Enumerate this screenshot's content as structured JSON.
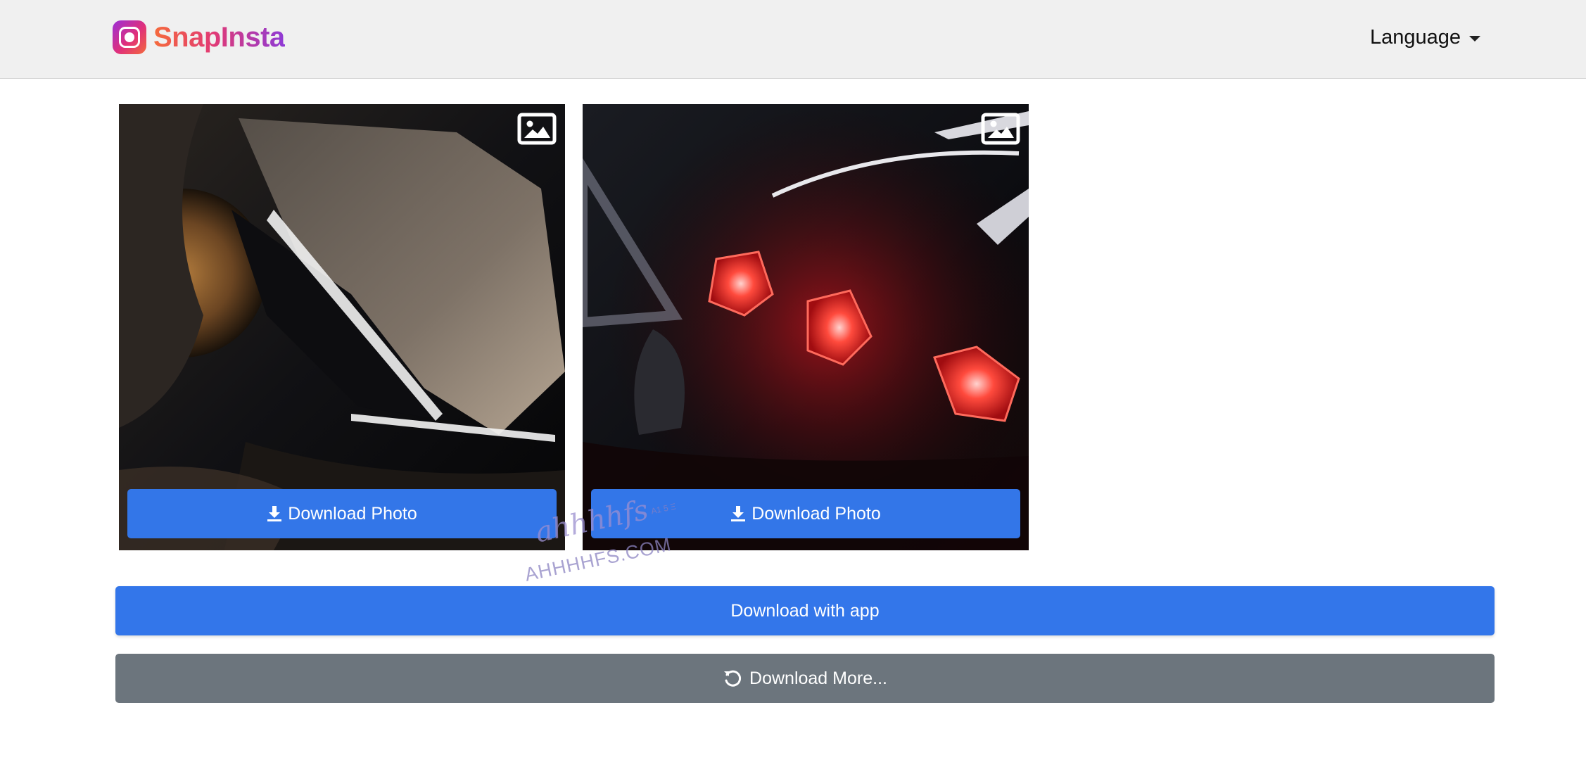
{
  "header": {
    "brand": "SnapInsta",
    "language_label": "Language"
  },
  "results": [
    {
      "button_label": "Download Photo",
      "media_icon": "image-icon"
    },
    {
      "button_label": "Download Photo",
      "media_icon": "image-icon"
    }
  ],
  "watermark": {
    "script": "ahhhhfs",
    "small": "A1 5 Ξ",
    "domain": "AHHHHFS.COM"
  },
  "actions": {
    "download_app_label": "Download with app",
    "download_more_label": "Download More..."
  },
  "colors": {
    "primary": "#3376e8",
    "secondary": "#6c757d",
    "navbar_bg": "#f0f0f0"
  }
}
